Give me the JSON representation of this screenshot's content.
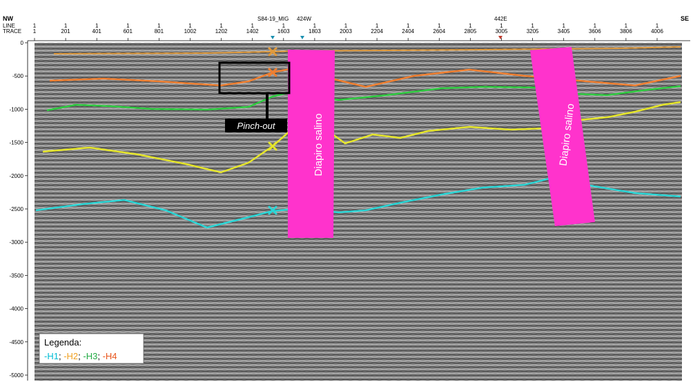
{
  "header": {
    "left_dir": "NW",
    "right_dir": "SE",
    "row_line_label": "LINE",
    "row_trace_label": "TRACE",
    "markers": [
      {
        "label": "S84-19_MIG",
        "color": "#1a8fb0",
        "trace": 1553
      },
      {
        "label": "424W",
        "color": "#1a8fb0",
        "trace": 1753
      },
      {
        "label": "442E",
        "color": "#c0392b",
        "trace": 3005
      }
    ],
    "traces": [
      "1",
      "201",
      "401",
      "601",
      "801",
      "1002",
      "1202",
      "1402",
      "1603",
      "1803",
      "2003",
      "2204",
      "2404",
      "2604",
      "2805",
      "3005",
      "3205",
      "3405",
      "3606",
      "3806",
      "4006"
    ],
    "line_value": "1"
  },
  "y_axis": {
    "ticks": [
      "0",
      "-500",
      "-1000",
      "-1500",
      "-2000",
      "-2500",
      "-3000",
      "-3500",
      "-4000",
      "-4500",
      "-5000"
    ]
  },
  "annotations": {
    "diapiro_left": "Diapiro salino",
    "diapiro_right": "Diapiro salino",
    "pinch_out": "Pinch-out"
  },
  "legend": {
    "title": "Legenda:",
    "items": [
      {
        "label": "-H1",
        "color": "#00bcd4"
      },
      {
        "label": "-H2",
        "color": "#f0a020"
      },
      {
        "label": "-H3",
        "color": "#22aa44"
      },
      {
        "label": "-H4",
        "color": "#e8541a"
      }
    ],
    "separator": "; "
  },
  "colors": {
    "diapir": "#ff33cc",
    "h1": "#2ad6d6",
    "h2": "#e6e62a",
    "h3": "#2ecc40",
    "h4": "#f07f30",
    "top": "#e0a040",
    "seismic_bg": "#7d7d7d"
  }
}
